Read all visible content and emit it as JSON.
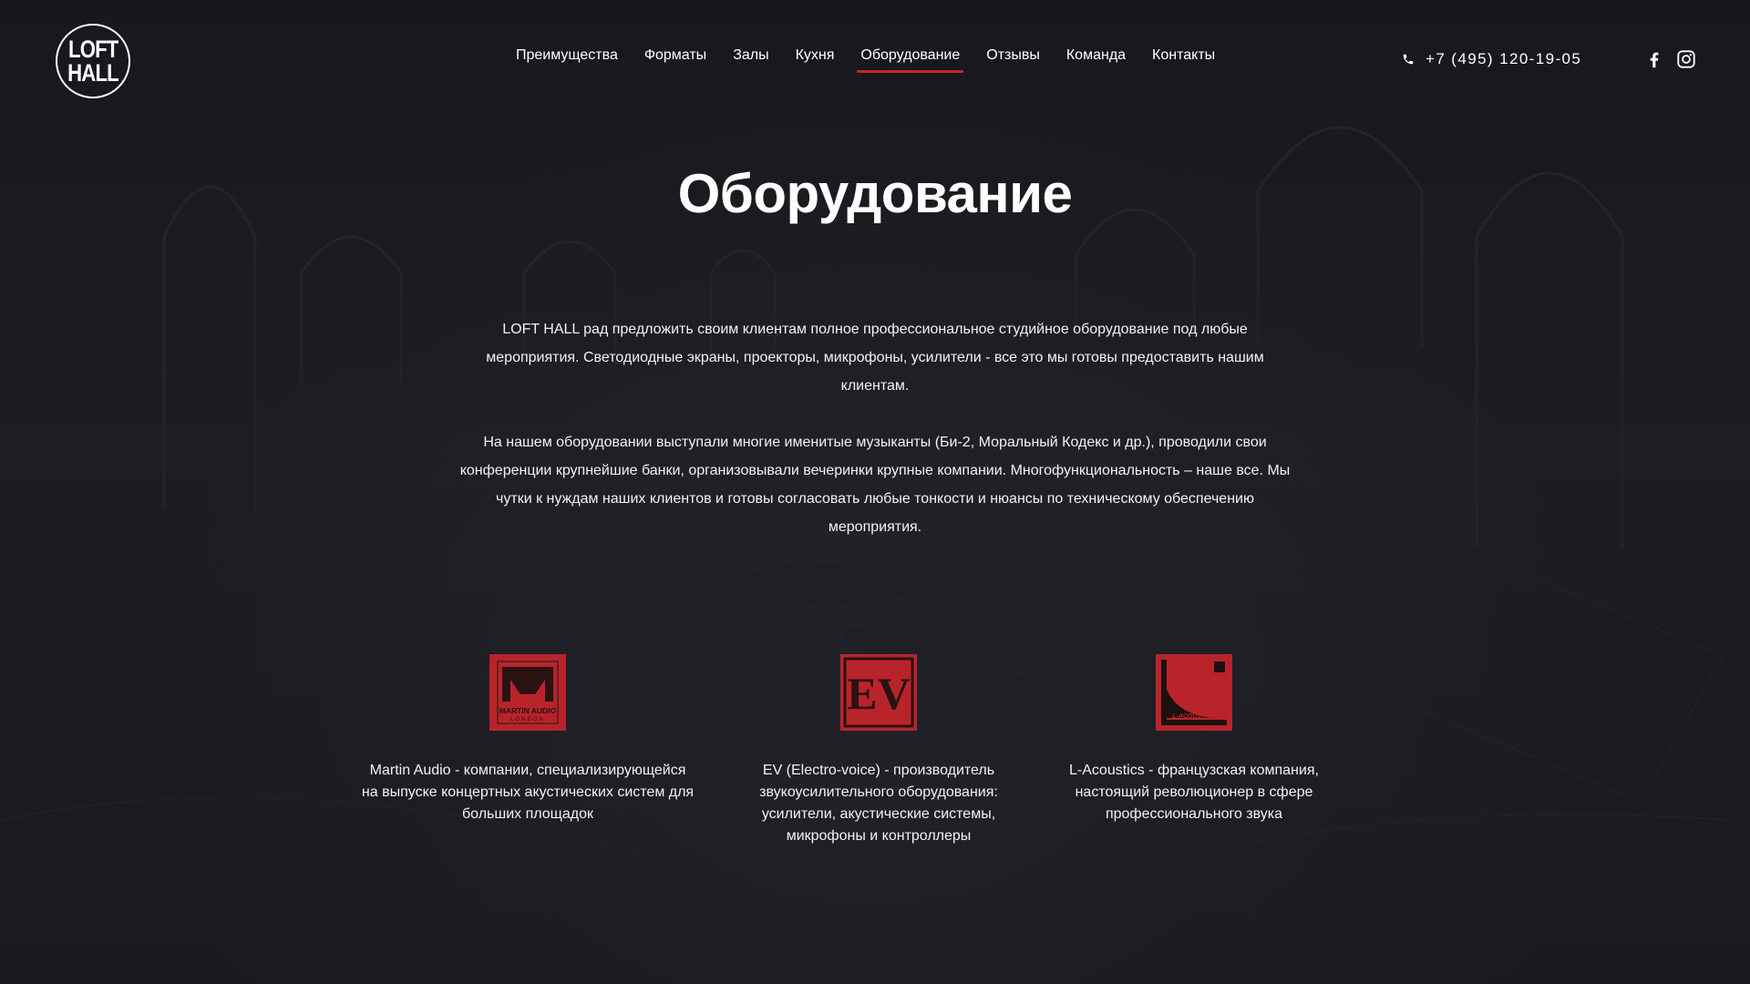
{
  "header": {
    "logo_line1": "LOFT",
    "logo_line2": "HALL",
    "nav": [
      {
        "label": "Преимущества"
      },
      {
        "label": "Форматы"
      },
      {
        "label": "Залы"
      },
      {
        "label": "Кухня"
      },
      {
        "label": "Оборудование",
        "active": true
      },
      {
        "label": "Отзывы"
      },
      {
        "label": "Команда"
      },
      {
        "label": "Контакты"
      }
    ],
    "phone": "+7 (495) 120-19-05",
    "social": [
      "facebook-icon",
      "instagram-icon"
    ]
  },
  "main": {
    "title": "Оборудование",
    "intro_1": "LOFT HALL рад предложить своим клиентам полное профессиональное студийное оборудование под любые мероприятия. Светодиодные экраны, проекторы, микрофоны, усилители - все это мы готовы предоставить нашим клиентам.",
    "intro_2": "На нашем оборудовании выступали многие именитые музыканты (Би-2, Моральный Кодекс и др.), проводили свои конференции крупнейшие банки, организовывали вечеринки крупные компании. Многофункциональность – наше все. Мы чутки к нуждам наших клиентов и готовы согласовать любые тонкости и нюансы по техническому обеспечению мероприятия.",
    "brands": [
      {
        "logo_text_1": "MARTIN AUDIO",
        "logo_text_2": "LONDON",
        "description": "Martin Audio - компании, специализирующейся на выпуске концертных акустических систем для больших площадок"
      },
      {
        "logo_text_1": "EV",
        "description": "EV (Electro-voice) - производитель звукоусилительного оборудования: усилители, акустические системы, микрофоны и контроллеры"
      },
      {
        "logo_text_1": "L-ACOUSTICS",
        "description": "L-Acoustics - французская компания, настоящий революционер в сфере профессионального звука"
      }
    ]
  },
  "colors": {
    "accent": "#c8252c",
    "brand_logo_bg": "#b9242b",
    "background": "#1b1c20",
    "text": "#ffffff"
  }
}
